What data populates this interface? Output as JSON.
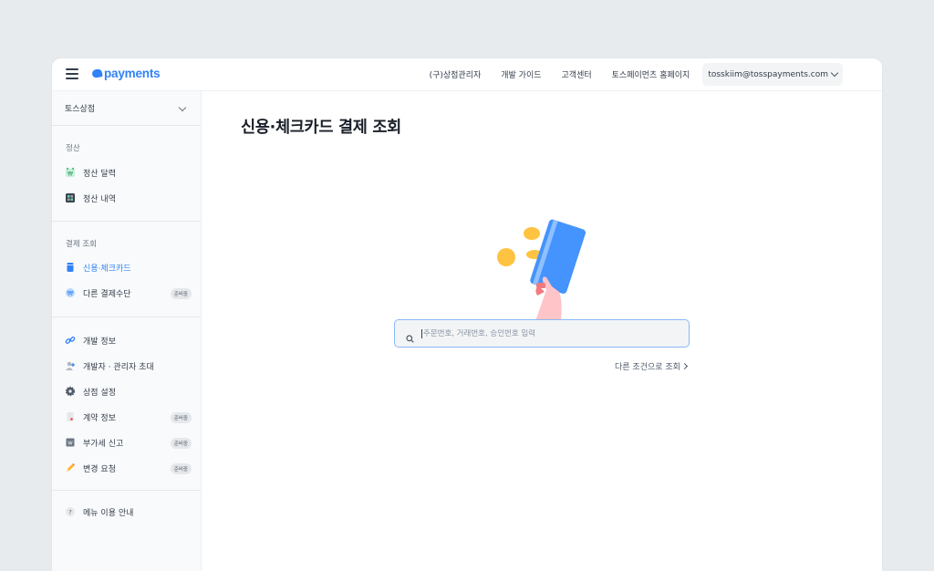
{
  "brand": {
    "logo_text": "payments",
    "color": "#3182f6"
  },
  "topnav": {
    "links": [
      "(구)상점관리자",
      "개발 가이드",
      "고객센터",
      "토스페이먼츠 홈페이지"
    ],
    "account": "tosskiim@tosspayments.com"
  },
  "sidebar": {
    "store": "토스상점",
    "settlement": {
      "title": "정산",
      "items": [
        {
          "label": "정산 달력",
          "icon": "settlement-calendar-icon"
        },
        {
          "label": "정산 내역",
          "icon": "settlement-history-icon"
        }
      ]
    },
    "payment": {
      "title": "결제 조회",
      "items": [
        {
          "label": "신용·체크카드",
          "icon": "card-icon",
          "active": true
        },
        {
          "label": "다른 결제수단",
          "icon": "won-coin-icon",
          "badge": "준비중"
        }
      ]
    },
    "manage": {
      "items": [
        {
          "label": "개발 정보",
          "icon": "link-icon"
        },
        {
          "label": "개발자 · 관리자 초대",
          "icon": "invite-user-icon"
        },
        {
          "label": "상점 설정",
          "icon": "gear-icon"
        },
        {
          "label": "계약 정보",
          "icon": "contract-icon",
          "badge": "준비중"
        },
        {
          "label": "부가세 신고",
          "icon": "vat-icon",
          "badge": "준비중"
        },
        {
          "label": "변경 요청",
          "icon": "pencil-icon",
          "badge": "준비중"
        }
      ]
    },
    "help": {
      "label": "메뉴 이용 안내",
      "icon": "question-icon"
    }
  },
  "main": {
    "title": "신용·체크카드 결제 조회",
    "search_placeholder": "주문번호, 거래번호, 승인번호 입력",
    "search_value": "",
    "other_conditions": "다른 조건으로 조회"
  }
}
